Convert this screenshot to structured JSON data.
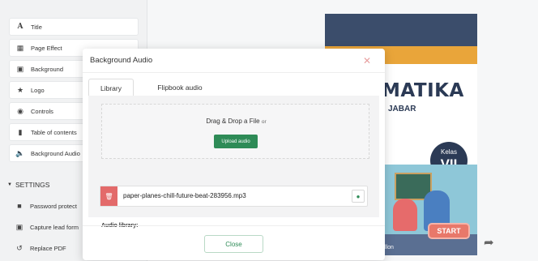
{
  "sidebar": {
    "items": [
      {
        "label": "Title",
        "icon": "title-icon"
      },
      {
        "label": "Page Effect",
        "icon": "page-effect-icon"
      },
      {
        "label": "Background",
        "icon": "image-icon"
      },
      {
        "label": "Logo",
        "icon": "star-icon"
      },
      {
        "label": "Controls",
        "icon": "toggle-icon"
      },
      {
        "label": "Table of contents",
        "icon": "bookmark-icon"
      },
      {
        "label": "Background Audio",
        "icon": "speaker-icon"
      }
    ],
    "settings_heading": "SETTINGS",
    "settings_items": [
      {
        "label": "Password protect",
        "icon": "lock-icon"
      },
      {
        "label": "Capture lead form",
        "icon": "form-icon"
      },
      {
        "label": "Replace PDF",
        "icon": "replace-icon"
      }
    ]
  },
  "book": {
    "title": "MATIKA",
    "subtitle": "JABAR",
    "kelas_label": "Kelas",
    "kelas_value": "VII",
    "author": "llon",
    "start_label": "START"
  },
  "modal": {
    "title": "Background Audio",
    "tabs": [
      "Library",
      "Flipbook audio"
    ],
    "drop_text": "Drag & Drop a File",
    "drop_or": "or",
    "upload_label": "Upload audio",
    "library_label": "Audio library:",
    "library_file": "paper-planes-chill-future-beat-283956.mp3",
    "close_label": "Close"
  },
  "colors": {
    "accent": "#2e8b57",
    "danger": "#e36a6a",
    "start": "#e8786a"
  }
}
